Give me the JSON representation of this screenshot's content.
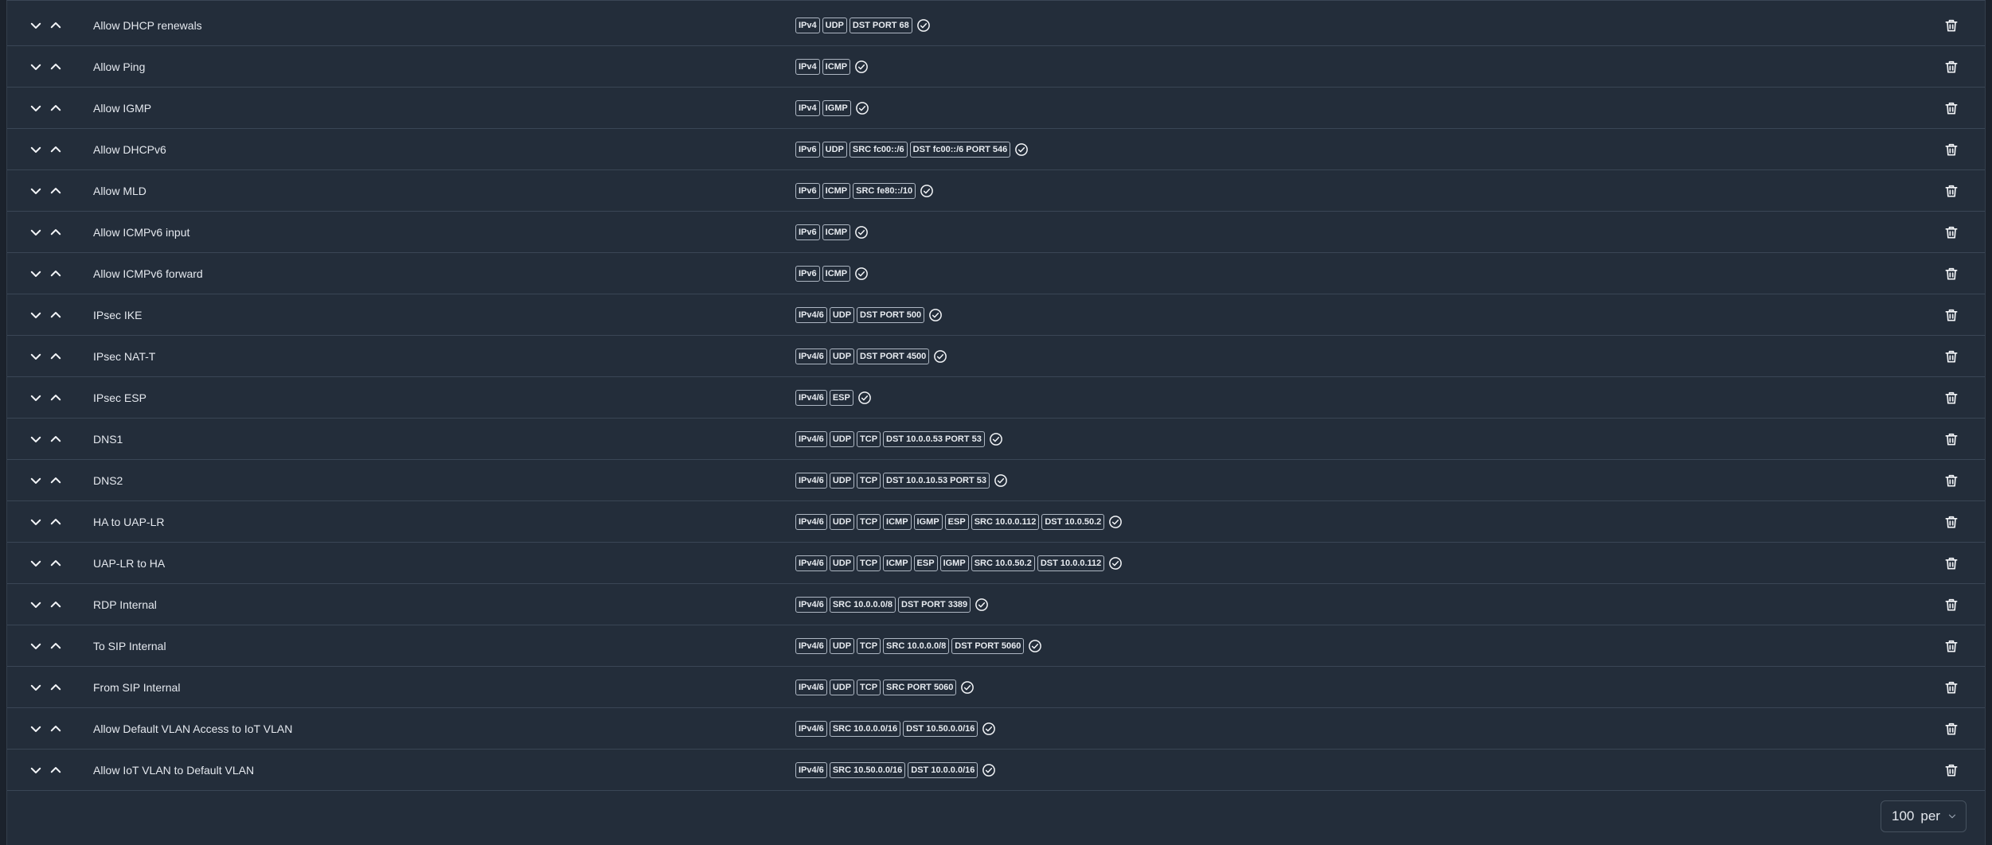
{
  "rules": [
    {
      "name": "Allow DHCP renewals",
      "tags": [
        "IPv4",
        "UDP",
        "DST PORT 68"
      ]
    },
    {
      "name": "Allow Ping",
      "tags": [
        "IPv4",
        "ICMP"
      ]
    },
    {
      "name": "Allow IGMP",
      "tags": [
        "IPv4",
        "IGMP"
      ]
    },
    {
      "name": "Allow DHCPv6",
      "tags": [
        "IPv6",
        "UDP",
        "SRC fc00::/6",
        "DST fc00::/6 PORT 546"
      ]
    },
    {
      "name": "Allow MLD",
      "tags": [
        "IPv6",
        "ICMP",
        "SRC fe80::/10"
      ]
    },
    {
      "name": "Allow ICMPv6 input",
      "tags": [
        "IPv6",
        "ICMP"
      ]
    },
    {
      "name": "Allow ICMPv6 forward",
      "tags": [
        "IPv6",
        "ICMP"
      ]
    },
    {
      "name": "IPsec IKE",
      "tags": [
        "IPv4/6",
        "UDP",
        "DST PORT 500"
      ]
    },
    {
      "name": "IPsec NAT-T",
      "tags": [
        "IPv4/6",
        "UDP",
        "DST PORT 4500"
      ]
    },
    {
      "name": "IPsec ESP",
      "tags": [
        "IPv4/6",
        "ESP"
      ]
    },
    {
      "name": "DNS1",
      "tags": [
        "IPv4/6",
        "UDP",
        "TCP",
        "DST 10.0.0.53 PORT 53"
      ]
    },
    {
      "name": "DNS2",
      "tags": [
        "IPv4/6",
        "UDP",
        "TCP",
        "DST 10.0.10.53 PORT 53"
      ]
    },
    {
      "name": "HA to UAP-LR",
      "tags": [
        "IPv4/6",
        "UDP",
        "TCP",
        "ICMP",
        "IGMP",
        "ESP",
        "SRC 10.0.0.112",
        "DST 10.0.50.2"
      ]
    },
    {
      "name": "UAP-LR to HA",
      "tags": [
        "IPv4/6",
        "UDP",
        "TCP",
        "ICMP",
        "ESP",
        "IGMP",
        "SRC 10.0.50.2",
        "DST 10.0.0.112"
      ]
    },
    {
      "name": "RDP Internal",
      "tags": [
        "IPv4/6",
        "SRC 10.0.0.0/8",
        "DST PORT 3389"
      ]
    },
    {
      "name": "To SIP Internal",
      "tags": [
        "IPv4/6",
        "UDP",
        "TCP",
        "SRC 10.0.0.0/8",
        "DST PORT 5060"
      ]
    },
    {
      "name": "From SIP Internal",
      "tags": [
        "IPv4/6",
        "UDP",
        "TCP",
        "SRC PORT 5060"
      ]
    },
    {
      "name": "Allow Default VLAN Access to IoT VLAN",
      "tags": [
        "IPv4/6",
        "SRC 10.0.0.0/16",
        "DST 10.50.0.0/16"
      ]
    },
    {
      "name": "Allow IoT VLAN to Default VLAN",
      "tags": [
        "IPv4/6",
        "SRC 10.50.0.0/16",
        "DST 10.0.0.0/16"
      ]
    }
  ],
  "icons": {
    "move_down": "chevron-down-icon",
    "move_up": "chevron-up-icon",
    "enabled": "check-circle-icon",
    "delete": "trash-icon"
  },
  "pagination": {
    "per_page_value": "100",
    "per_page_label": "per"
  },
  "colors": {
    "panel_bg": "#232d3a",
    "page_bg": "#1b222c",
    "divider": "#3a4655",
    "text": "#e4e8ee"
  }
}
